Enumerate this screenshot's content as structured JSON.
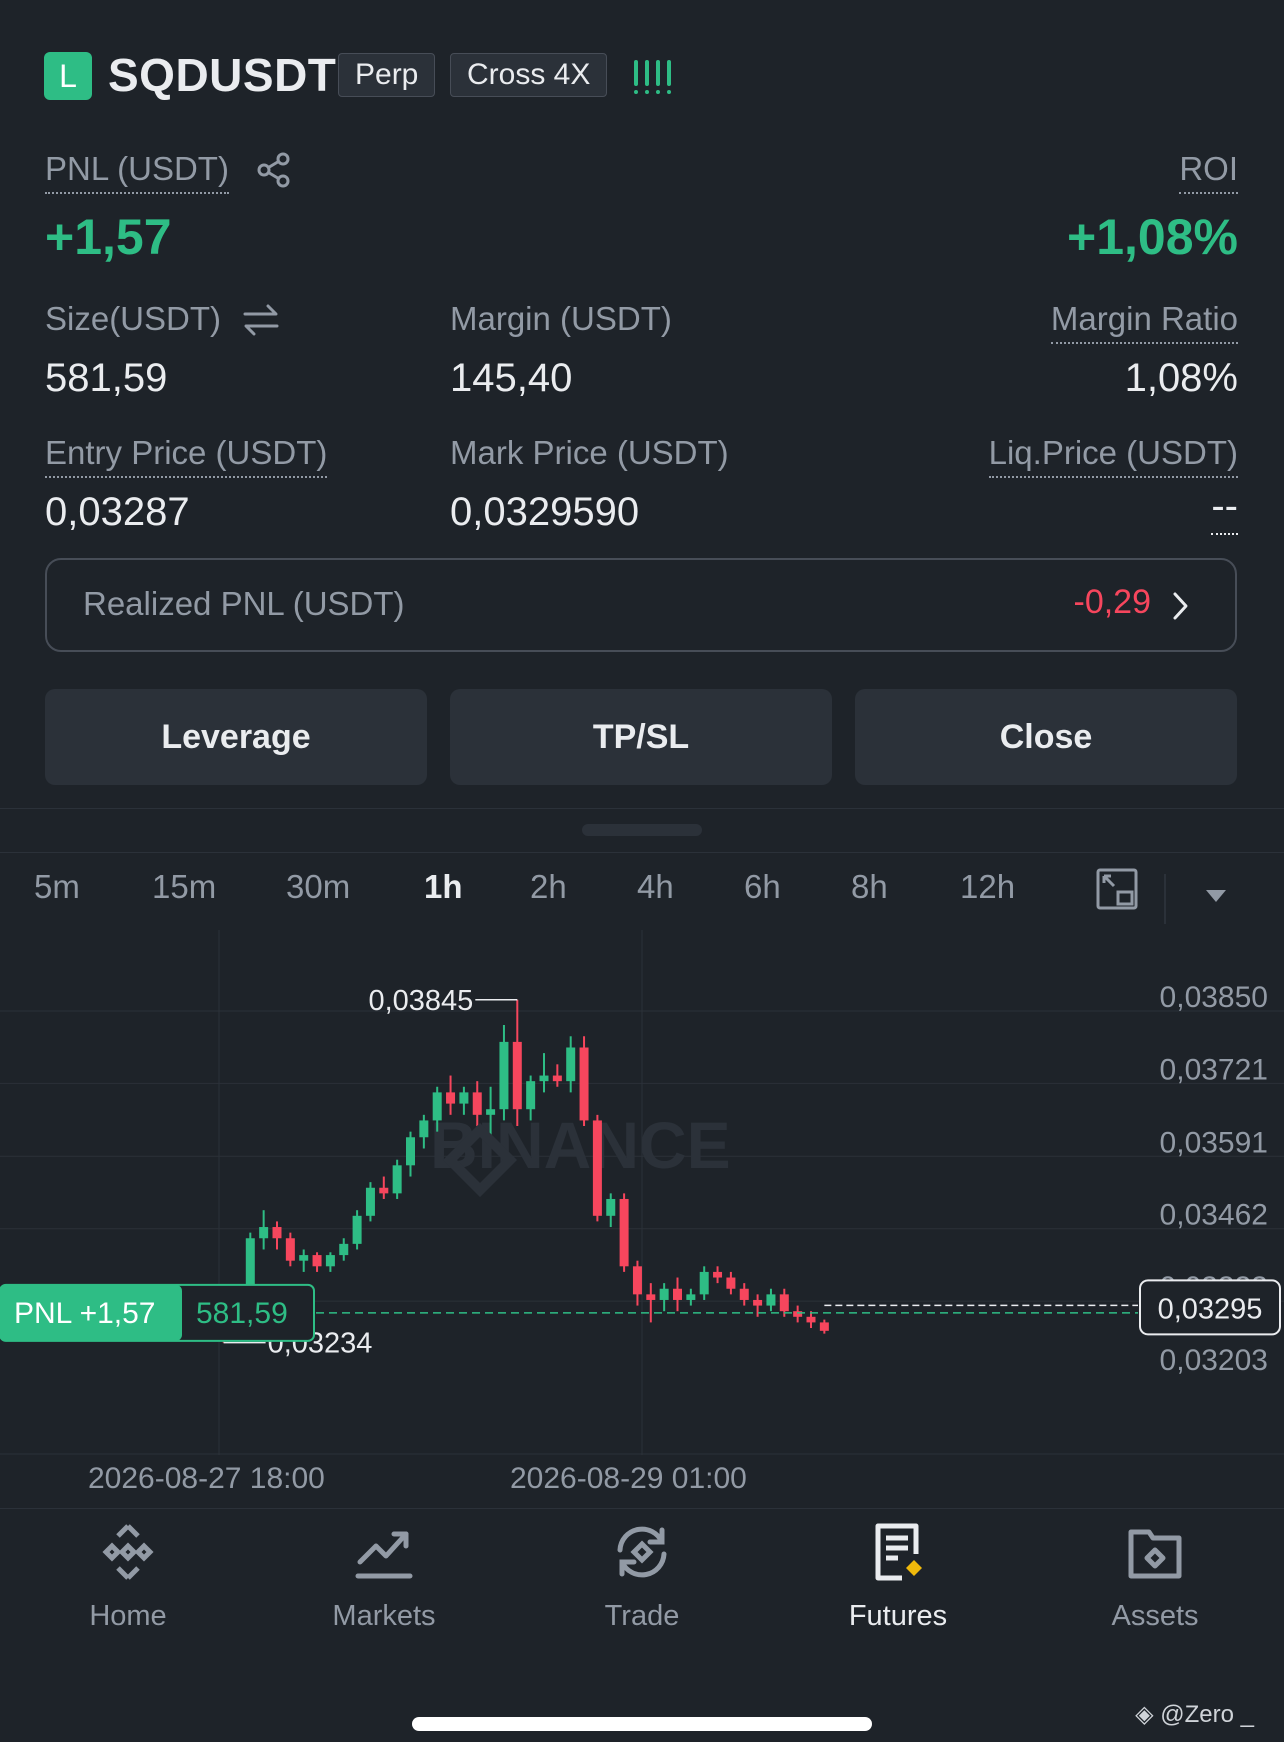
{
  "position": {
    "side_badge": "L",
    "symbol": "SQDUSDT",
    "type_tag": "Perp",
    "margin_tag": "Cross 4X",
    "pnl_label": "PNL (USDT)",
    "pnl_value": "+1,57",
    "roi_label": "ROI",
    "roi_value": "+1,08%",
    "size_label": "Size(USDT)",
    "size_value": "581,59",
    "margin_label": "Margin (USDT)",
    "margin_value": "145,40",
    "margin_ratio_label": "Margin Ratio",
    "margin_ratio_value": "1,08%",
    "entry_label": "Entry Price (USDT)",
    "entry_value": "0,03287",
    "mark_label": "Mark Price (USDT)",
    "mark_value": "0,0329590",
    "liq_label": "Liq.Price (USDT)",
    "liq_value": "--",
    "realized_label": "Realized PNL (USDT)",
    "realized_value": "-0,29"
  },
  "actions": {
    "leverage": "Leverage",
    "tpsl": "TP/SL",
    "close": "Close"
  },
  "timeframes": [
    "5m",
    "15m",
    "30m",
    "1h",
    "2h",
    "4h",
    "6h",
    "8h",
    "12h"
  ],
  "timeframe_active": "1h",
  "chart_data": {
    "type": "candlestick",
    "price_ticks": [
      "0,03850",
      "0,03721",
      "0,03591",
      "0,03462",
      "0,03333",
      "0,03203"
    ],
    "price_tick_values": [
      0.0385,
      0.03721,
      0.03591,
      0.03462,
      0.03333,
      0.03203
    ],
    "current_price_label": "0,03295",
    "current_price": 0.03295,
    "high_label": "0,03845",
    "high": 0.03845,
    "low_label": "0,03234",
    "low": 0.03234,
    "date_labels": [
      "2026-08-27 18:00",
      "2026-08-29 01:00"
    ],
    "pnl_tag": "PNL +1,57",
    "size_tag": "581,59",
    "entry_price": 0.03287,
    "watermark": "BINANCE",
    "candles": [
      [
        0.03302,
        0.03303,
        0.03298,
        0.03301
      ],
      [
        0.03301,
        0.03305,
        0.03297,
        0.03302
      ],
      [
        0.03302,
        0.03304,
        0.03298,
        0.033
      ],
      [
        0.033,
        0.03301,
        0.0329,
        0.03294
      ],
      [
        0.03294,
        0.03305,
        0.03292,
        0.03303
      ],
      [
        0.03303,
        0.03306,
        0.03295,
        0.03297
      ],
      [
        0.03297,
        0.03302,
        0.03294,
        0.03299
      ],
      [
        0.03299,
        0.03301,
        0.03292,
        0.03295
      ],
      [
        0.03295,
        0.03304,
        0.03293,
        0.03302
      ],
      [
        0.03302,
        0.03303,
        0.03296,
        0.03298
      ],
      [
        0.03298,
        0.03302,
        0.03295,
        0.033
      ],
      [
        0.033,
        0.03302,
        0.03296,
        0.03297
      ],
      [
        0.03297,
        0.03306,
        0.03295,
        0.03301
      ],
      [
        0.03301,
        0.03303,
        0.03294,
        0.03296
      ],
      [
        0.03296,
        0.03303,
        0.03293,
        0.033
      ],
      [
        0.033,
        0.03309,
        0.03288,
        0.03292
      ],
      [
        0.03292,
        0.03296,
        0.03234,
        0.03286
      ],
      [
        0.03286,
        0.033,
        0.0328,
        0.03296
      ],
      [
        0.03296,
        0.0343,
        0.0329,
        0.0342
      ],
      [
        0.0342,
        0.0347,
        0.034,
        0.0344
      ],
      [
        0.0344,
        0.0345,
        0.034,
        0.0342
      ],
      [
        0.0342,
        0.0343,
        0.0337,
        0.0338
      ],
      [
        0.0338,
        0.034,
        0.0336,
        0.0339
      ],
      [
        0.0339,
        0.03395,
        0.0336,
        0.0337
      ],
      [
        0.0337,
        0.03395,
        0.0336,
        0.0339
      ],
      [
        0.0339,
        0.0342,
        0.0338,
        0.0341
      ],
      [
        0.0341,
        0.0347,
        0.034,
        0.0346
      ],
      [
        0.0346,
        0.0352,
        0.0345,
        0.0351
      ],
      [
        0.0351,
        0.0353,
        0.0349,
        0.035
      ],
      [
        0.035,
        0.0356,
        0.0349,
        0.0355
      ],
      [
        0.0355,
        0.0361,
        0.0353,
        0.036
      ],
      [
        0.036,
        0.0364,
        0.0358,
        0.0363
      ],
      [
        0.0363,
        0.0369,
        0.0361,
        0.0368
      ],
      [
        0.0368,
        0.0371,
        0.0364,
        0.0366
      ],
      [
        0.0366,
        0.0369,
        0.0364,
        0.0368
      ],
      [
        0.0368,
        0.037,
        0.0362,
        0.0364
      ],
      [
        0.0364,
        0.0369,
        0.036,
        0.0365
      ],
      [
        0.0365,
        0.038,
        0.0363,
        0.0377
      ],
      [
        0.0377,
        0.03845,
        0.0362,
        0.0365
      ],
      [
        0.0365,
        0.0371,
        0.0363,
        0.037
      ],
      [
        0.037,
        0.0375,
        0.0368,
        0.0371
      ],
      [
        0.0371,
        0.0373,
        0.0369,
        0.037
      ],
      [
        0.037,
        0.0378,
        0.0368,
        0.0376
      ],
      [
        0.0376,
        0.0378,
        0.0362,
        0.0363
      ],
      [
        0.0363,
        0.0364,
        0.0345,
        0.0346
      ],
      [
        0.0346,
        0.035,
        0.0344,
        0.0349
      ],
      [
        0.0349,
        0.035,
        0.0336,
        0.0337
      ],
      [
        0.0337,
        0.0338,
        0.033,
        0.0332
      ],
      [
        0.0332,
        0.0334,
        0.0327,
        0.0331
      ],
      [
        0.0331,
        0.0334,
        0.0329,
        0.0333
      ],
      [
        0.0333,
        0.0335,
        0.0329,
        0.0331
      ],
      [
        0.0331,
        0.0333,
        0.033,
        0.0332
      ],
      [
        0.0332,
        0.0337,
        0.0331,
        0.0336
      ],
      [
        0.0336,
        0.0337,
        0.0334,
        0.0335
      ],
      [
        0.0335,
        0.0336,
        0.0332,
        0.0333
      ],
      [
        0.0333,
        0.0334,
        0.033,
        0.0331
      ],
      [
        0.0331,
        0.0332,
        0.0328,
        0.033
      ],
      [
        0.033,
        0.0333,
        0.0329,
        0.0332
      ],
      [
        0.0332,
        0.0333,
        0.0328,
        0.0329
      ],
      [
        0.0329,
        0.033,
        0.0327,
        0.0328
      ],
      [
        0.0328,
        0.0329,
        0.0326,
        0.0327
      ],
      [
        0.0327,
        0.03275,
        0.0325,
        0.03255
      ]
    ]
  },
  "nav": {
    "home": "Home",
    "markets": "Markets",
    "trade": "Trade",
    "futures": "Futures",
    "assets": "Assets"
  },
  "credit": "@Zero _",
  "colors": {
    "bg": "#1e2329",
    "up": "#2ebd85",
    "down": "#f6465d",
    "accent": "#f0b90b"
  }
}
